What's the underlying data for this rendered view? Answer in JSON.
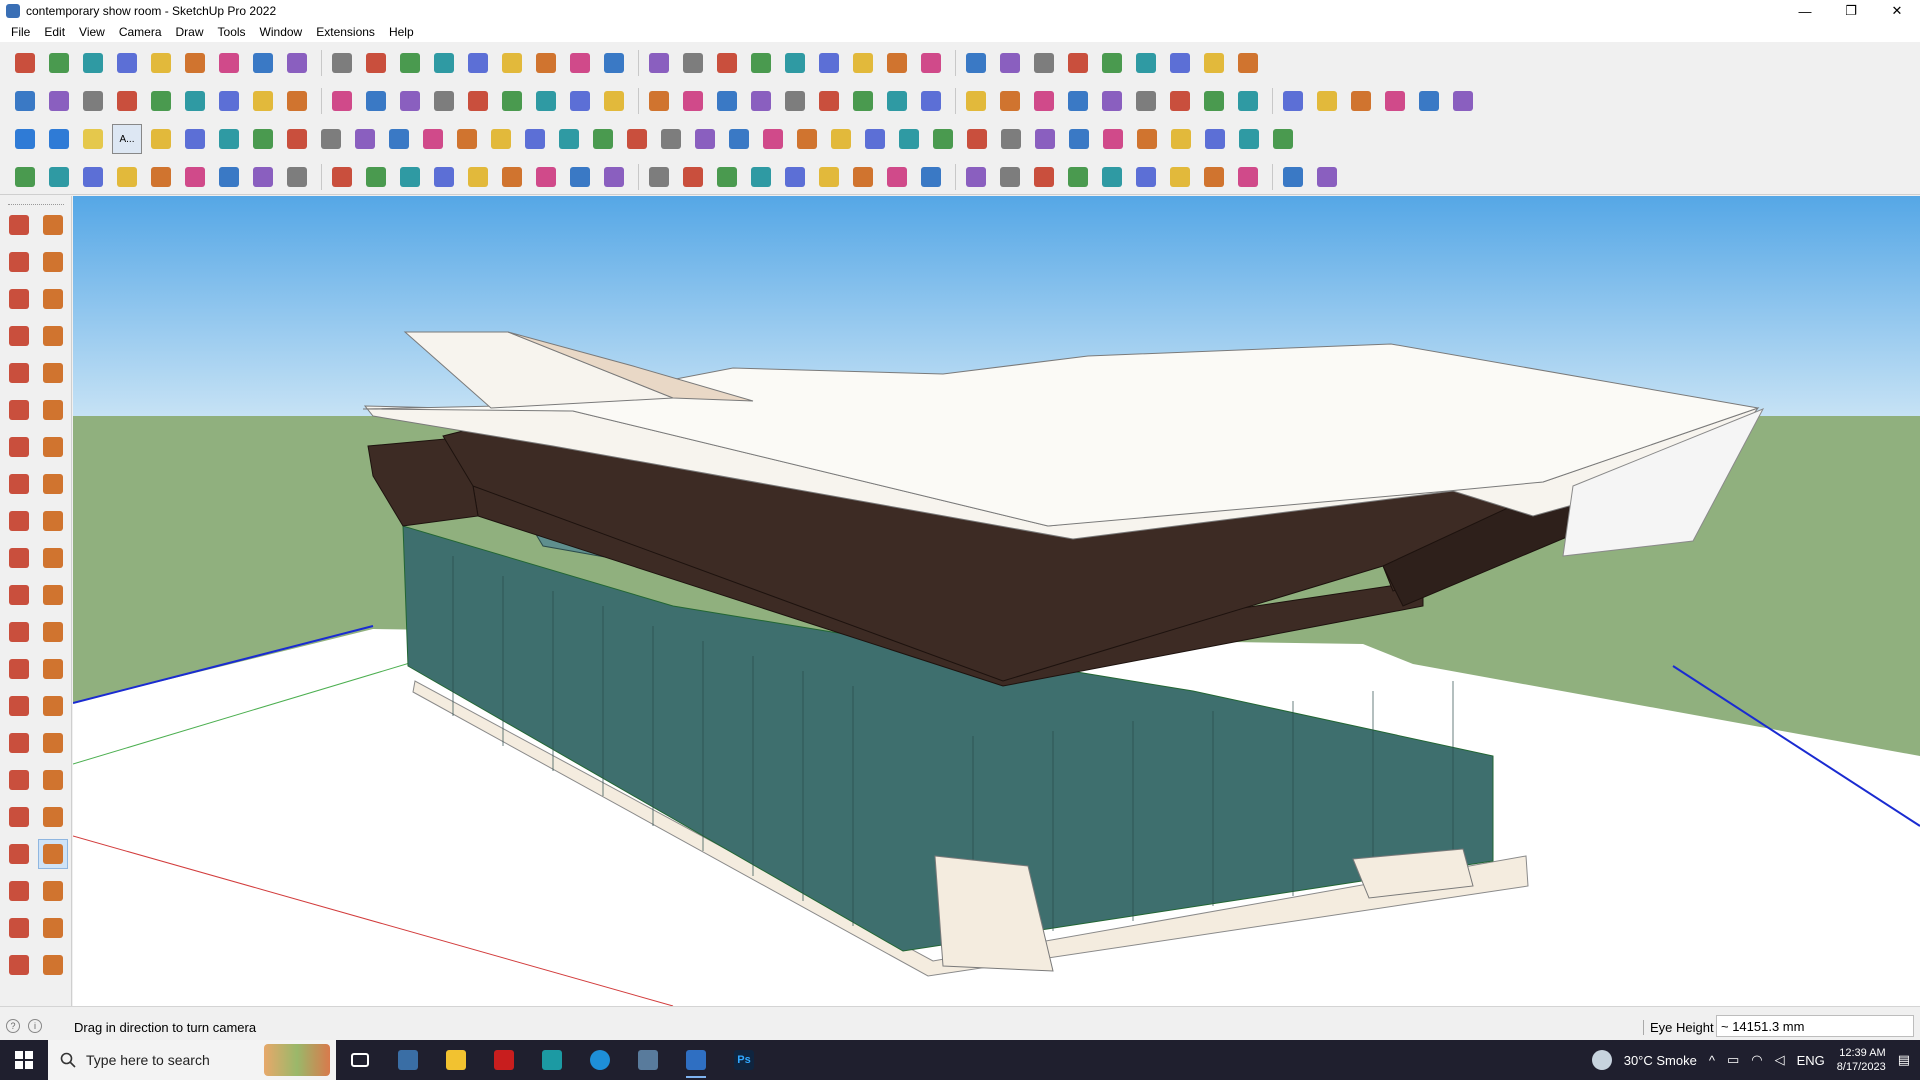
{
  "window": {
    "title": "contemporary show room - SketchUp Pro 2022",
    "minimize_glyph": "—",
    "restore_glyph": "❐",
    "close_glyph": "✕"
  },
  "menu": [
    "File",
    "Edit",
    "View",
    "Camera",
    "Draw",
    "Tools",
    "Window",
    "Extensions",
    "Help"
  ],
  "toolbar_rows": [
    {
      "count": 36
    },
    {
      "count": 42
    },
    {
      "count": 38
    },
    {
      "count": 38
    }
  ],
  "text_style_button": {
    "label": "A..."
  },
  "left_toolbar": [
    "select-icon",
    "orbit-icon",
    "paint-bucket-icon",
    "eraser-icon",
    "walls-icon",
    "tape-icon",
    "line-icon",
    "freehand-icon",
    "rectangle-icon",
    "rotated-rect-icon",
    "circle-icon",
    "polygon-icon",
    "arc-icon",
    "pie-icon",
    "arc3-icon",
    "arc2-icon",
    "move-icon",
    "push-pull-icon",
    "rotate-icon",
    "follow-me-icon",
    "scale-icon",
    "offset-icon",
    "tape-measure-icon",
    "dimension-icon",
    "protractor-icon",
    "text-icon",
    "axes-icon",
    "3d-text-icon",
    "orbit2-icon",
    "pan-icon",
    "zoom-icon",
    "zoom-window-icon",
    "zoom-extents-icon",
    "previous-icon",
    "position-camera-icon",
    "look-around-icon",
    "walk-icon",
    "section-plane-icon",
    "outliner-icon",
    "layers-icon",
    "styles-icon",
    "scenes-icon"
  ],
  "status": {
    "message": "Drag in direction to turn camera",
    "measure_label": "Eye Height",
    "measure_value": "~ 14151.3 mm"
  },
  "taskbar": {
    "search_placeholder": "Type here to search",
    "weather": "30°C  Smoke",
    "language": "ENG",
    "time": "12:39 AM",
    "date": "8/17/2023"
  },
  "colors": {
    "sky_top": "#55a7e6",
    "sky_bottom": "#c6e2f5",
    "ground": "#90b07e",
    "roof": "#f7f4ee",
    "band": "#3d2b24",
    "glass": "#3e6f6e"
  }
}
